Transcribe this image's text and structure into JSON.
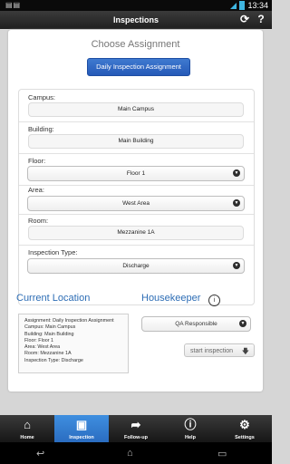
{
  "status_bar": {
    "time": "13:34",
    "left_icons": "▤▤"
  },
  "header": {
    "title": "Inspections"
  },
  "choose": {
    "title": "Choose Assignment",
    "button_label": "Daily Inspection Assignment"
  },
  "fields": [
    {
      "label": "Campus:",
      "value": "Main Campus",
      "kind": "text"
    },
    {
      "label": "Building:",
      "value": "Main Building",
      "kind": "text"
    },
    {
      "label": "Floor:",
      "value": "Floor 1",
      "kind": "select"
    },
    {
      "label": "Area:",
      "value": "West Area",
      "kind": "select"
    },
    {
      "label": "Room:",
      "value": "Mezzanine 1A",
      "kind": "text"
    },
    {
      "label": "Inspection Type:",
      "value": "Discharge",
      "kind": "select"
    }
  ],
  "current_location": {
    "title": "Current Location",
    "lines": [
      "Assignment: Daily Inspection Assignment",
      "Campus: Main Campus",
      "Building: Main Building",
      "Floor: Floor 1",
      "Area: West Area",
      "Room: Mezzanine 1A",
      "Inspection Type: Discharge"
    ]
  },
  "housekeeper": {
    "title": "Housekeeper",
    "info_icon": "i",
    "selected": "QA Responsible",
    "start_label": "start inspection"
  },
  "tabs": [
    {
      "label": "Home",
      "icon": "home-icon"
    },
    {
      "label": "Inspection",
      "icon": "inspection-icon",
      "active": true
    },
    {
      "label": "Follow-up",
      "icon": "followup-icon"
    },
    {
      "label": "Help",
      "icon": "help-icon"
    },
    {
      "label": "Settings",
      "icon": "gear-icon"
    }
  ]
}
